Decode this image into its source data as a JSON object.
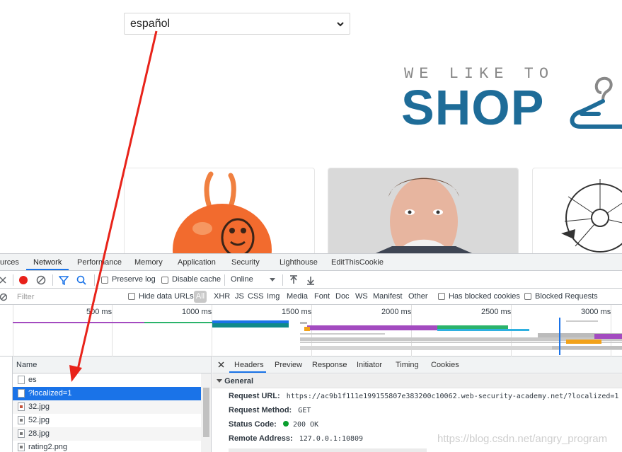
{
  "page": {
    "language_select": {
      "value": "español"
    },
    "logo": {
      "top_line": "WE LIKE TO",
      "main": "SHOP"
    }
  },
  "devtools": {
    "tabs": [
      {
        "label": "urces"
      },
      {
        "label": "Network"
      },
      {
        "label": "Performance"
      },
      {
        "label": "Memory"
      },
      {
        "label": "Application"
      },
      {
        "label": "Security"
      },
      {
        "label": "Lighthouse"
      },
      {
        "label": "EditThisCookie"
      }
    ],
    "toolbar": {
      "preserve_log": "Preserve log",
      "disable_cache": "Disable cache",
      "throttling": "Online"
    },
    "filter": {
      "placeholder": "Filter",
      "hide_data_urls": "Hide data URLs",
      "types": [
        "All",
        "XHR",
        "JS",
        "CSS",
        "Img",
        "Media",
        "Font",
        "Doc",
        "WS",
        "Manifest",
        "Other"
      ],
      "has_blocked_cookies": "Has blocked cookies",
      "blocked_requests": "Blocked Requests"
    },
    "overview": {
      "ticks": [
        "500 ms",
        "1000 ms",
        "1500 ms",
        "2000 ms",
        "2500 ms",
        "3000 ms"
      ]
    },
    "requests": {
      "column_name": "Name",
      "rows": [
        {
          "name": "es",
          "icon": "file-icon"
        },
        {
          "name": "?localized=1",
          "icon": "file-icon",
          "selected": true
        },
        {
          "name": "32.jpg",
          "icon": "image-icon"
        },
        {
          "name": "52.jpg",
          "icon": "image-icon"
        },
        {
          "name": "28.jpg",
          "icon": "image-icon"
        },
        {
          "name": "rating2.png",
          "icon": "image-icon"
        }
      ]
    },
    "detail": {
      "tabs": [
        "Headers",
        "Preview",
        "Response",
        "Initiator",
        "Timing",
        "Cookies"
      ],
      "general_label": "General",
      "request_url_label": "Request URL:",
      "request_url": "https://ac9b1f111e199155807e383200c10062.web-security-academy.net/?localized=1",
      "request_method_label": "Request Method:",
      "request_method": "GET",
      "status_code_label": "Status Code:",
      "status_code": "200 OK",
      "remote_address_label": "Remote Address:",
      "remote_address": "127.0.0.1:10809"
    }
  },
  "watermark": "https://blog.csdn.net/angry_program",
  "colors": {
    "accent": "#1a73e8",
    "logo_blue": "#1e6c98",
    "arrow_red": "#e8231a"
  }
}
